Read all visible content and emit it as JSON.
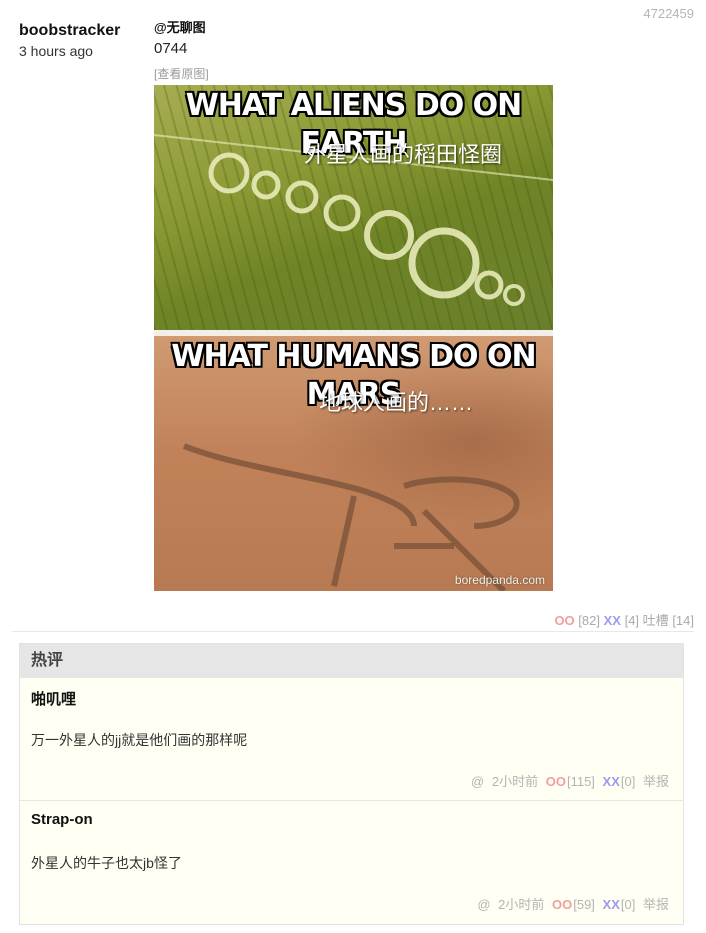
{
  "post": {
    "id": "4722459",
    "author": "boobstracker",
    "time_ago": "3 hours ago",
    "mention": "@无聊图",
    "code": "0744",
    "view_original": "[查看原图]",
    "meme": {
      "top_caption": "WHAT ALIENS DO ON EARTH",
      "top_sub": "外星人画的稻田怪圈",
      "bottom_caption": "WHAT HUMANS DO ON MARS",
      "bottom_sub": "地球人画的……",
      "watermark": "boredpanda.com"
    },
    "votes": {
      "oo_label": "OO",
      "oo_count": "[82]",
      "xx_label": "XX",
      "xx_count": "[4]",
      "tucao_label": "吐槽",
      "tucao_count": "[14]"
    }
  },
  "hot_comments": {
    "title": "热评",
    "items": [
      {
        "author": "啪叽哩",
        "text": "万一外星人的jj就是他们画的那样呢",
        "at": "@",
        "time": "2小时前",
        "oo_label": "OO",
        "oo_count": "[115]",
        "xx_label": "XX",
        "xx_count": "[0]",
        "report": "举报"
      },
      {
        "author": "Strap-on",
        "text": "外星人的牛子也太jb怪了",
        "at": "@",
        "time": "2小时前",
        "oo_label": "OO",
        "oo_count": "[59]",
        "xx_label": "XX",
        "xx_count": "[0]",
        "report": "举报"
      }
    ]
  },
  "colors": {
    "oo": "#f29ea0",
    "xx": "#9b9bef",
    "hot_bg": "#fffff3",
    "hot_header_bg": "#e6e6e6"
  }
}
